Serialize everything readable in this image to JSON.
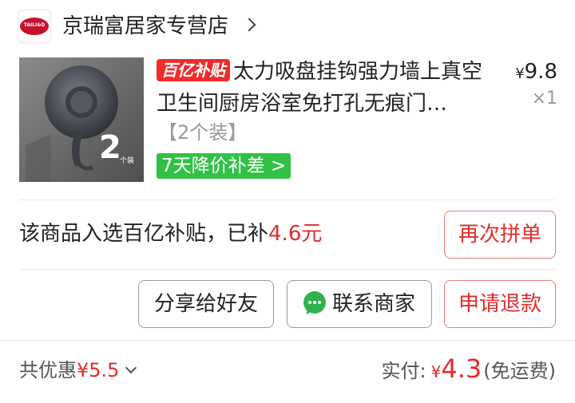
{
  "store": {
    "logo_text": "TAILI&D",
    "name": "京瑞富居家专营店"
  },
  "product": {
    "badge": "百亿补贴",
    "title": "太力吸盘挂钩强力墙上真空卫生间厨房浴室免打孔无痕门…",
    "price_symbol": "¥",
    "price": "9.8",
    "quantity": "×1",
    "spec": "【2个装】",
    "promo_tag": "7天降价补差",
    "thumb_count": "2",
    "thumb_unit": "个装"
  },
  "subsidy": {
    "text": "该商品入选百亿补贴，已补",
    "amount": "4.6元"
  },
  "buttons": {
    "reorder": "再次拼单",
    "share": "分享给好友",
    "contact": "联系商家",
    "refund": "申请退款"
  },
  "footer": {
    "discount_label": "共优惠",
    "discount_amount": "¥5.5",
    "paid_label": "实付:",
    "paid_currency": "¥",
    "paid_amount": "4.3",
    "shipping_note": "(免运费)"
  },
  "colors": {
    "accent_red": "#e22c2c",
    "badge_red": "#f02c2c",
    "promo_green": "#31c145",
    "chat_green": "#2fb24c"
  },
  "icons": {
    "store_chevron": "chevron-right-icon",
    "discount_chevron": "chevron-down-icon",
    "contact": "chat-bubble-icon"
  }
}
